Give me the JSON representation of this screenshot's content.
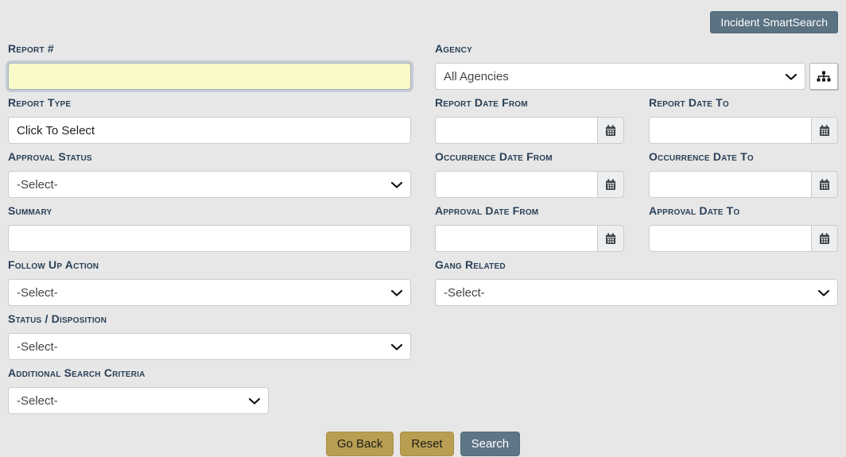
{
  "header": {
    "smart_search_button": "Incident SmartSearch"
  },
  "form": {
    "left": {
      "report_number": {
        "label": "Report #",
        "value": ""
      },
      "report_type": {
        "label": "Report Type",
        "value": "Click To Select"
      },
      "approval_status": {
        "label": "Approval Status",
        "value": "-Select-"
      },
      "summary": {
        "label": "Summary",
        "value": ""
      },
      "follow_up_action": {
        "label": "Follow Up Action",
        "value": "-Select-"
      },
      "status_disposition": {
        "label": "Status / Disposition",
        "value": "-Select-"
      },
      "additional_search_criteria": {
        "label": "Additional Search Criteria",
        "value": "-Select-"
      }
    },
    "right": {
      "agency": {
        "label": "Agency",
        "value": "All Agencies"
      },
      "report_date_from": {
        "label": "Report Date From",
        "value": ""
      },
      "report_date_to": {
        "label": "Report Date To",
        "value": ""
      },
      "occurrence_date_from": {
        "label": "Occurrence Date From",
        "value": ""
      },
      "occurrence_date_to": {
        "label": "Occurrence Date To",
        "value": ""
      },
      "approval_date_from": {
        "label": "Approval Date From",
        "value": ""
      },
      "approval_date_to": {
        "label": "Approval Date To",
        "value": ""
      },
      "gang_related": {
        "label": "Gang Related",
        "value": "-Select-"
      }
    },
    "actions": {
      "go_back": "Go Back",
      "reset": "Reset",
      "search": "Search"
    }
  },
  "icons": {
    "agency_lookup": "sitemap-icon",
    "date_picker": "calendar-icon",
    "dropdown": "chevron-down-icon"
  },
  "colors": {
    "page_background": "#e7e7e7",
    "label_navy": "#2a4158",
    "accent_slate": "#5d7585",
    "accent_gold": "#b99e52",
    "highlight_yellow": "#fafac8"
  }
}
